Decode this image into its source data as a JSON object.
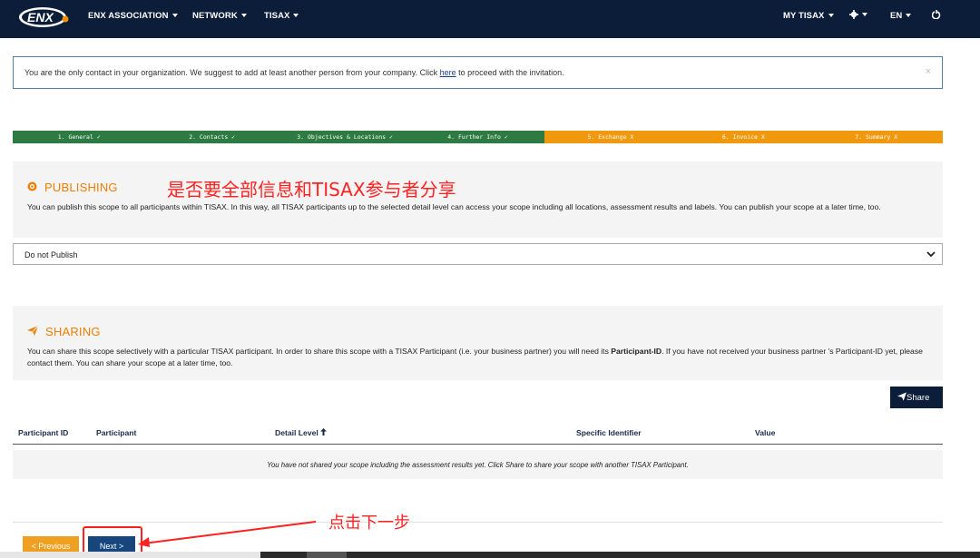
{
  "nav": {
    "logo_text": "ENX",
    "items": [
      {
        "label": "ENX ASSOCIATION"
      },
      {
        "label": "NETWORK"
      },
      {
        "label": "TISAX"
      }
    ],
    "right_items": [
      {
        "label": "MY TISAX"
      },
      {
        "label": "EN"
      }
    ],
    "icons": [
      "gear-icon",
      "logout-icon"
    ]
  },
  "alert": {
    "text_before": "You are the only contact in your organization. We suggest to add at least another person from your company. Click ",
    "link": "here",
    "text_after": " to proceed with the invitation.",
    "close": "×"
  },
  "steps": [
    {
      "label": "1. General ✓",
      "status": "done"
    },
    {
      "label": "2. Contacts ✓",
      "status": "done"
    },
    {
      "label": "3. Objectives & Locations ✓",
      "status": "done"
    },
    {
      "label": "4. Further Info ✓",
      "status": "done"
    },
    {
      "label": "5. Exchange X",
      "status": "todo"
    },
    {
      "label": "6. Invoice X",
      "status": "todo"
    },
    {
      "label": "7. Summary X",
      "status": "todo"
    }
  ],
  "publishing": {
    "title": "PUBLISHING",
    "annotation": "是否要全部信息和TISAX参与者分享",
    "text": "You can publish this scope to all participants within TISAX. In this way, all TISAX participants up to the selected detail level can access your scope including all locations, assessment results and labels. You can publish your scope at a later time, too.",
    "select_value": "Do not Publish"
  },
  "sharing": {
    "title": "SHARING",
    "text_before": "You can share this scope selectively with a particular TISAX participant. In order to share this scope with a TISAX Participant (i.e. your business partner) you will need its ",
    "text_bold": "Participant-ID",
    "text_after": ". If you have not received your business partner 's Participant-ID yet, please contact them. You can share your scope at a later time, too.",
    "share_button": "Share"
  },
  "table": {
    "columns": [
      "Participant ID",
      "Participant",
      "Detail Level",
      "Specific Identifier",
      "Value"
    ],
    "sort_indicator": "🠕",
    "empty_message": "You have not shared your scope including the assessment results yet. Click Share to share your scope with another TISAX Participant."
  },
  "footer": {
    "prev_label": "< Previous",
    "next_label": "Next >",
    "annotation": "点击下一步"
  },
  "colors": {
    "nav_bg": "#0c1d3a",
    "step_done": "#2e7a43",
    "step_todo": "#f0980e",
    "accent_orange": "#ef7d00",
    "annotation_red": "#ff2222"
  }
}
